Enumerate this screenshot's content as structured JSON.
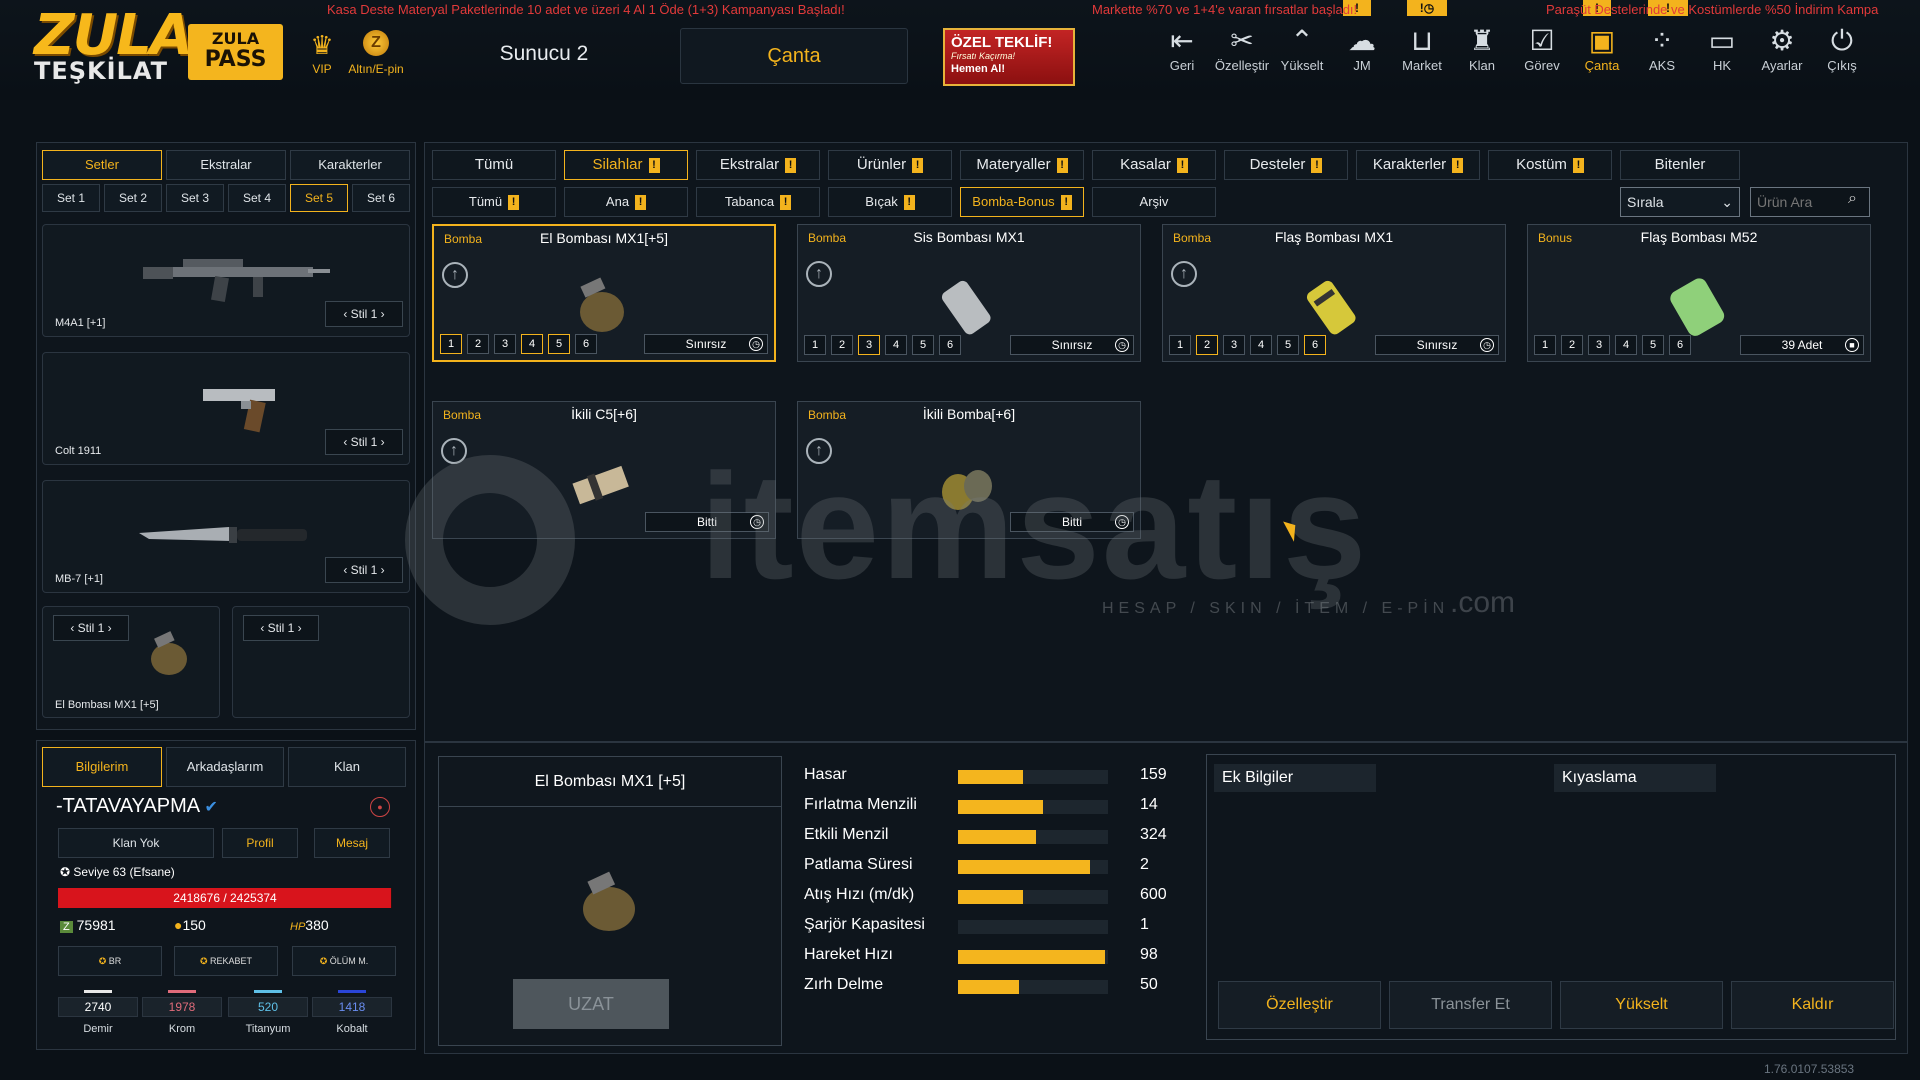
{
  "header": {
    "logo_top": "ZULA",
    "logo_bottom": "TEŞKİLAT",
    "pass_top": "ZULA",
    "pass_bottom": "PASS",
    "vip_label": "VIP",
    "altin_label": "Altın/E-pin",
    "server": "Sunucu 2",
    "bag_tab": "Çanta",
    "offer": {
      "title": "ÖZEL TEKLİF!",
      "subtitle": "Fırsatı Kaçırma!",
      "cta": "Hemen Al!"
    },
    "nav": [
      {
        "label": "Geri",
        "icon": "back-icon"
      },
      {
        "label": "Özelleştir",
        "icon": "tools-icon"
      },
      {
        "label": "Yükselt",
        "icon": "upgrade-icon"
      },
      {
        "label": "JM",
        "icon": "jm-icon"
      },
      {
        "label": "Market",
        "icon": "cart-icon"
      },
      {
        "label": "Klan",
        "icon": "clan-icon"
      },
      {
        "label": "Görev",
        "icon": "task-icon"
      },
      {
        "label": "Çanta",
        "icon": "bag-icon"
      },
      {
        "label": "AKS",
        "icon": "aks-icon"
      },
      {
        "label": "HK",
        "icon": "wallet-icon"
      },
      {
        "label": "Ayarlar",
        "icon": "gear-icon"
      },
      {
        "label": "Çıkış",
        "icon": "power-icon"
      }
    ],
    "warnings": [
      "!",
      "!",
      "!",
      "!"
    ]
  },
  "ticker": [
    "Kasa Deste Materyal Paketlerinde 10 adet ve üzeri 4 Al 1 Öde (1+3) Kampanyası Başladı!",
    "Markette %70 ve 1+4'e varan fırsatlar başladı!",
    "Paraşüt Destelerinde ve Kostümlerde %50 İndirim Kampa"
  ],
  "left": {
    "tabs": [
      "Setler",
      "Ekstralar",
      "Karakterler"
    ],
    "sets": [
      "Set 1",
      "Set 2",
      "Set 3",
      "Set 4",
      "Set 5",
      "Set 6"
    ],
    "weapons": [
      {
        "name": "M4A1 [+1]",
        "stil": "Stil 1"
      },
      {
        "name": "Colt 1911",
        "stil": "Stil 1"
      },
      {
        "name": "MB-7 [+1]",
        "stil": "Stil 1"
      }
    ],
    "small_slots": [
      {
        "name": "El Bombası MX1 [+5]",
        "stil": "Stil 1"
      },
      {
        "name": "",
        "stil": "Stil 1"
      }
    ]
  },
  "profile": {
    "tabs": [
      "Bilgilerim",
      "Arkadaşlarım",
      "Klan"
    ],
    "username": "-TATAVAYAPMA",
    "clan": "Klan Yok",
    "profile_btn": "Profil",
    "message_btn": "Mesaj",
    "level": "Seviye 63 (Efsane)",
    "xp": "2418676 / 2425374",
    "xp_fraction": 0.997,
    "currencies": [
      {
        "icon": "z-coin-icon",
        "value": "75981"
      },
      {
        "icon": "gold-coin-icon",
        "value": "150"
      },
      {
        "icon": "hp-icon",
        "value": "380"
      }
    ],
    "modes": [
      "BR",
      "REKABET",
      "ÖLÜM M."
    ],
    "resources": [
      {
        "name": "Demir",
        "value": "2740",
        "color": "#e8e8e8"
      },
      {
        "name": "Krom",
        "value": "1978",
        "color": "#e06b7a"
      },
      {
        "name": "Titanyum",
        "value": "520",
        "color": "#5fc0e8"
      },
      {
        "name": "Kobalt",
        "value": "1418",
        "color": "#2a45d8"
      }
    ]
  },
  "filters": {
    "row1": [
      {
        "label": "Tümü",
        "ex": false
      },
      {
        "label": "Silahlar",
        "ex": true
      },
      {
        "label": "Ekstralar",
        "ex": true
      },
      {
        "label": "Ürünler",
        "ex": true
      },
      {
        "label": "Materyaller",
        "ex": true
      },
      {
        "label": "Kasalar",
        "ex": true
      },
      {
        "label": "Desteler",
        "ex": true
      },
      {
        "label": "Karakterler",
        "ex": true
      },
      {
        "label": "Kostüm",
        "ex": true
      },
      {
        "label": "Bitenler",
        "ex": false
      }
    ],
    "row2": [
      {
        "label": "Tümü",
        "ex": true
      },
      {
        "label": "Ana",
        "ex": true
      },
      {
        "label": "Tabanca",
        "ex": true
      },
      {
        "label": "Bıçak",
        "ex": true
      },
      {
        "label": "Bomba-Bonus",
        "ex": true
      },
      {
        "label": "Arşiv",
        "ex": false
      }
    ],
    "sort": "Sırala",
    "search_placeholder": "Ürün Ara"
  },
  "items": [
    {
      "cat": "Bomba",
      "name": "El Bombası MX1[+5]",
      "dur": "Sınırsız",
      "on": [
        1,
        4,
        5
      ]
    },
    {
      "cat": "Bomba",
      "name": "Sis Bombası MX1",
      "dur": "Sınırsız",
      "on": [
        3
      ]
    },
    {
      "cat": "Bomba",
      "name": "Flaş Bombası MX1",
      "dur": "Sınırsız",
      "on": [
        2,
        6
      ]
    },
    {
      "cat": "Bonus",
      "name": "Flaş Bombası M52",
      "dur": "39 Adet",
      "on": []
    },
    {
      "cat": "Bomba",
      "name": "İkili C5[+6]",
      "dur": "Bitti",
      "on": []
    },
    {
      "cat": "Bomba",
      "name": "İkili Bomba[+6]",
      "dur": "Bitti",
      "on": []
    }
  ],
  "detail": {
    "name": "El Bombası MX1 [+5]",
    "extend": "UZAT",
    "stats": [
      {
        "label": "Hasar",
        "value": "159",
        "fill": 0.43
      },
      {
        "label": "Fırlatma Menzili",
        "value": "14",
        "fill": 0.57
      },
      {
        "label": "Etkili Menzil",
        "value": "324",
        "fill": 0.52
      },
      {
        "label": "Patlama Süresi",
        "value": "2",
        "fill": 0.88
      },
      {
        "label": "Atış Hızı (m/dk)",
        "value": "600",
        "fill": 0.43
      },
      {
        "label": "Şarjör Kapasitesi",
        "value": "1",
        "fill": 0.0
      },
      {
        "label": "Hareket Hızı",
        "value": "98",
        "fill": 0.98
      },
      {
        "label": "Zırh Delme",
        "value": "50",
        "fill": 0.41
      }
    ],
    "extra_title": "Ek Bilgiler",
    "compare_title": "Kıyaslama",
    "actions": [
      "Özelleştir",
      "Transfer Et",
      "Yükselt",
      "Kaldır"
    ]
  },
  "watermark": {
    "brand": "itemsatış",
    "tagline": "HESAP / SKIN / İTEM / E-PİN",
    "suffix": ".com"
  },
  "version": "1.76.0107.53853",
  "colors": {
    "accent": "#f3b31d",
    "ticker": "#e23a3a",
    "xp": "#d8141c"
  }
}
